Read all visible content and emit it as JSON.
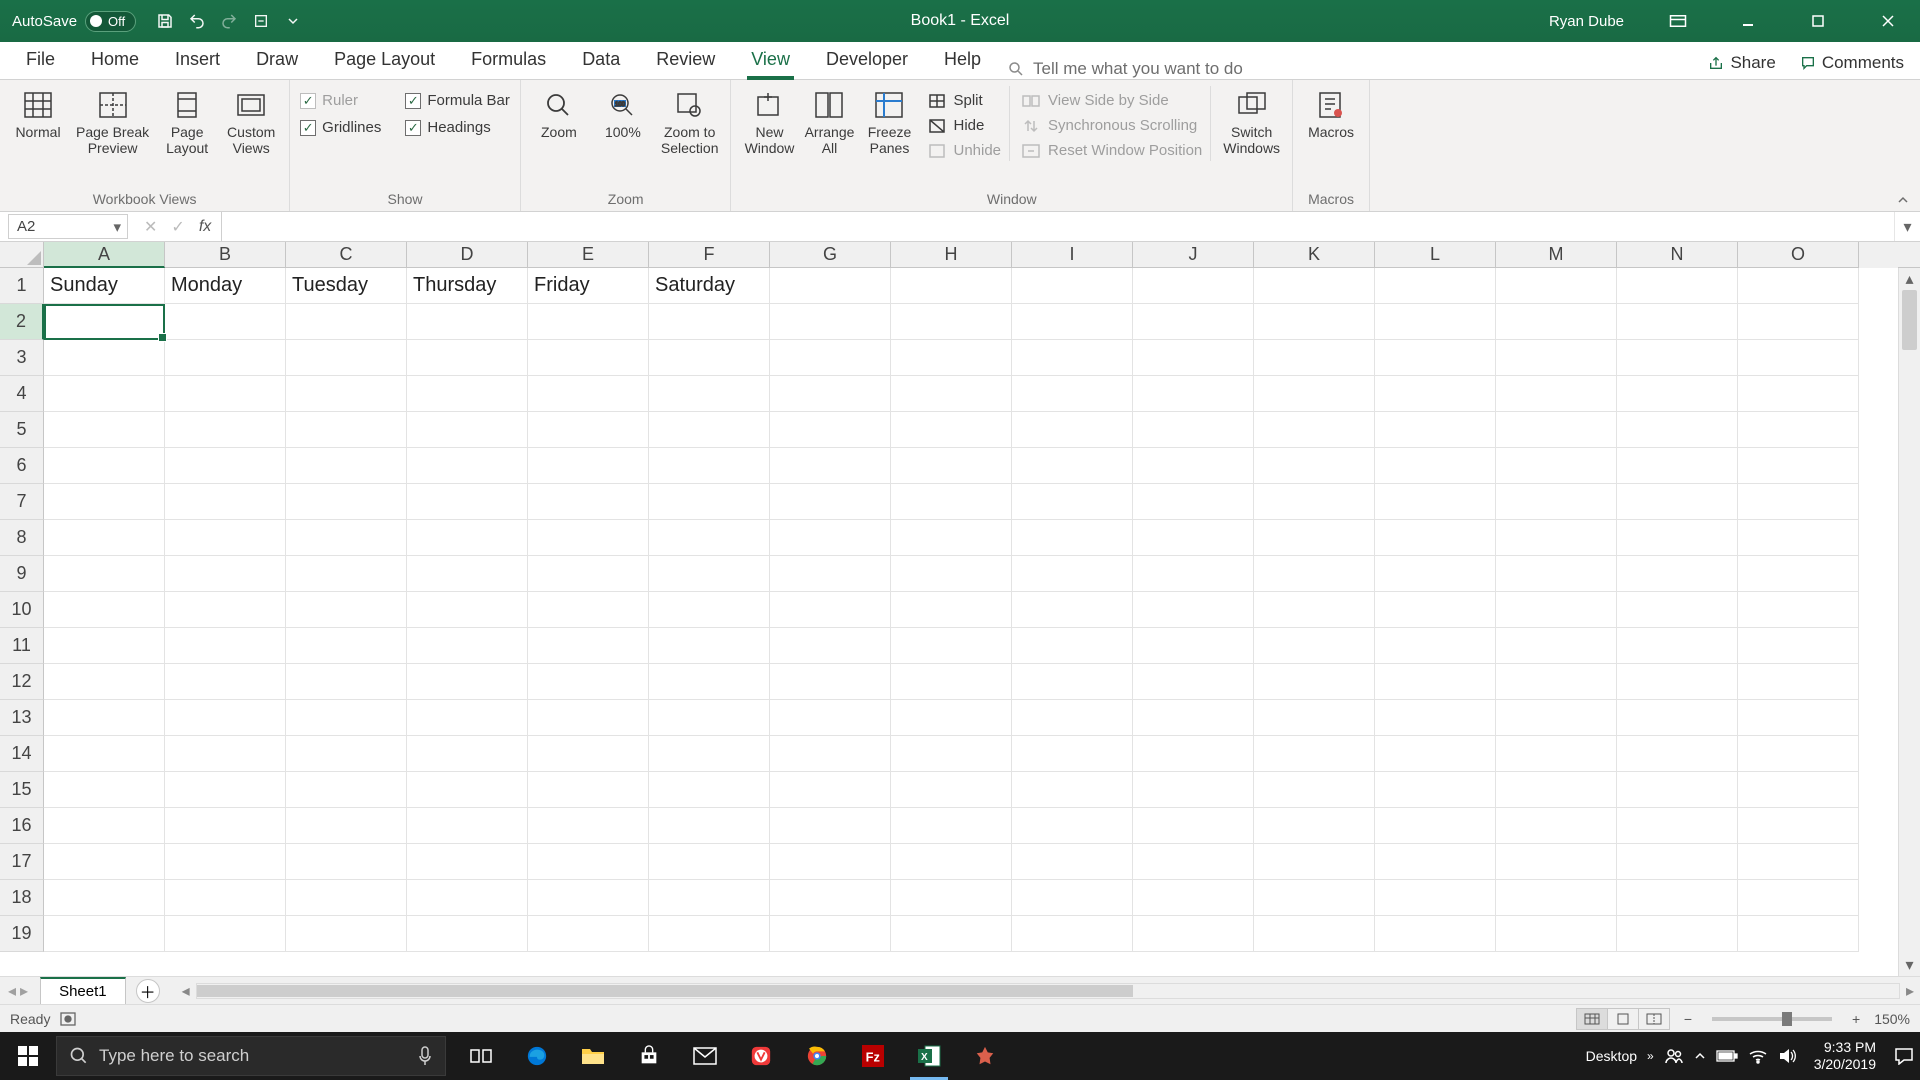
{
  "titlebar": {
    "autosave_label": "AutoSave",
    "autosave_state": "Off",
    "doc_title": "Book1 - Excel",
    "username": "Ryan Dube"
  },
  "ribbon_tabs": {
    "items": [
      "File",
      "Home",
      "Insert",
      "Draw",
      "Page Layout",
      "Formulas",
      "Data",
      "Review",
      "View",
      "Developer",
      "Help"
    ],
    "active": "View",
    "search_placeholder": "Tell me what you want to do",
    "share": "Share",
    "comments": "Comments"
  },
  "ribbon": {
    "groups": {
      "workbook_views": {
        "label": "Workbook Views",
        "normal": "Normal",
        "page_break": "Page Break\nPreview",
        "page_layout": "Page\nLayout",
        "custom_views": "Custom\nViews"
      },
      "show": {
        "label": "Show",
        "ruler": "Ruler",
        "formula_bar": "Formula Bar",
        "gridlines": "Gridlines",
        "headings": "Headings"
      },
      "zoom": {
        "label": "Zoom",
        "zoom": "Zoom",
        "hundred": "100%",
        "zoom_to_selection": "Zoom to\nSelection"
      },
      "window": {
        "label": "Window",
        "new_window": "New\nWindow",
        "arrange_all": "Arrange\nAll",
        "freeze_panes": "Freeze\nPanes",
        "split": "Split",
        "hide": "Hide",
        "unhide": "Unhide",
        "view_sbs": "View Side by Side",
        "sync_scroll": "Synchronous Scrolling",
        "reset_pos": "Reset Window Position",
        "switch": "Switch\nWindows"
      },
      "macros": {
        "label": "Macros",
        "btn": "Macros"
      }
    }
  },
  "formula_bar": {
    "name_box": "A2",
    "formula": ""
  },
  "grid": {
    "columns": [
      "A",
      "B",
      "C",
      "D",
      "E",
      "F",
      "G",
      "H",
      "I",
      "J",
      "K",
      "L",
      "M",
      "N",
      "O"
    ],
    "selected_col": "A",
    "selected_row": 2,
    "visible_rows": 19,
    "row1": [
      "Sunday",
      "Monday",
      "Tuesday",
      "Thursday",
      "Friday",
      "Saturday"
    ]
  },
  "sheetbar": {
    "sheets": [
      "Sheet1"
    ]
  },
  "statusbar": {
    "ready": "Ready",
    "zoom": "150%"
  },
  "taskbar": {
    "search_placeholder": "Type here to search",
    "desktop_label": "Desktop",
    "time": "9:33 PM",
    "date": "3/20/2019"
  }
}
